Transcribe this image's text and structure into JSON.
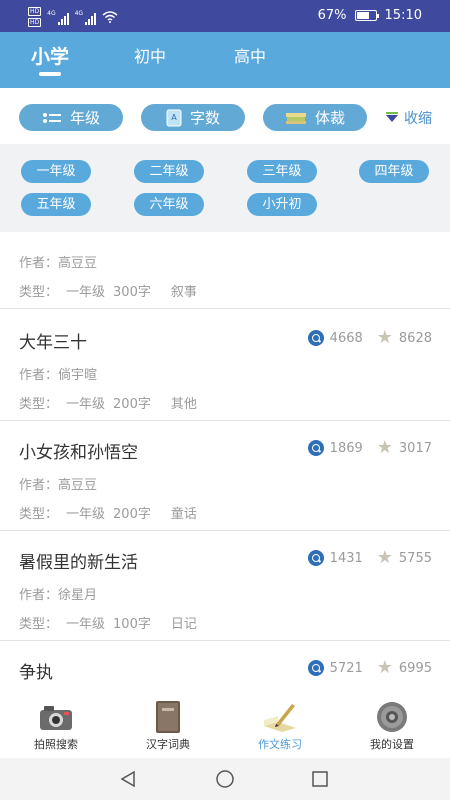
{
  "status_bar": {
    "hd_labels": [
      "HD",
      "HD"
    ],
    "network": [
      "4G",
      "4G"
    ],
    "battery_percent": "67%",
    "battery_level": 0.67,
    "time": "15:10"
  },
  "level_tabs": [
    {
      "label": "小学",
      "active": true
    },
    {
      "label": "初中",
      "active": false
    },
    {
      "label": "高中",
      "active": false
    }
  ],
  "filters": {
    "grade_label": "年级",
    "word_count_label": "字数",
    "genre_label": "体裁",
    "collapse_label": "收缩",
    "word_count_icon_text": "A"
  },
  "grades": [
    "一年级",
    "二年级",
    "三年级",
    "四年级",
    "五年级",
    "六年级",
    "小升初"
  ],
  "essays": [
    {
      "title": "",
      "author_prefix": "作者：",
      "author": "高豆豆",
      "type_prefix": "类型：",
      "grade": "一年级",
      "words": "300字",
      "genre": "叙事",
      "views": "",
      "likes": ""
    },
    {
      "title": "大年三十",
      "author_prefix": "作者：",
      "author": "倘宇暄",
      "type_prefix": "类型：",
      "grade": "一年级",
      "words": "200字",
      "genre": "其他",
      "views": "4668",
      "likes": "8628"
    },
    {
      "title": "小女孩和孙悟空",
      "author_prefix": "作者：",
      "author": "高豆豆",
      "type_prefix": "类型：",
      "grade": "一年级",
      "words": "200字",
      "genre": "童话",
      "views": "1869",
      "likes": "3017"
    },
    {
      "title": "暑假里的新生活",
      "author_prefix": "作者：",
      "author": "徐星月",
      "type_prefix": "类型：",
      "grade": "一年级",
      "words": "100字",
      "genre": "日记",
      "views": "1431",
      "likes": "5755"
    },
    {
      "title": "争执",
      "author_prefix": "",
      "author": "",
      "type_prefix": "",
      "grade": "",
      "words": "",
      "genre": "",
      "views": "5721",
      "likes": "6995"
    }
  ],
  "bottom_nav": [
    {
      "label": "拍照搜索",
      "icon": "camera-icon",
      "active": false
    },
    {
      "label": "汉字词典",
      "icon": "book-icon",
      "active": false
    },
    {
      "label": "作文练习",
      "icon": "pen-icon",
      "active": true
    },
    {
      "label": "我的设置",
      "icon": "gear-icon",
      "active": false
    }
  ],
  "colors": {
    "status_bar": "#3f4a9e",
    "header": "#5aa9dc",
    "pill": "#63a9d6",
    "accent_text": "#4a9ad8",
    "view_icon": "#2f6fb8"
  }
}
